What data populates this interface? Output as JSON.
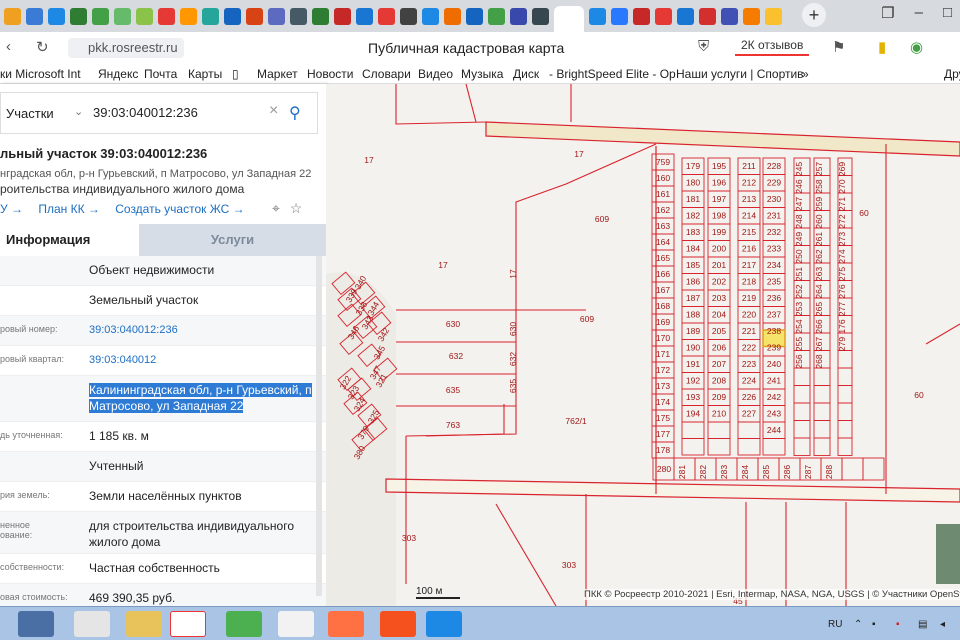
{
  "browser": {
    "url": "pkk.rosreestr.ru",
    "page_title": "Публичная кадастровая карта",
    "reviews_label": "2К отзывов",
    "bookmarks": [
      "ки Microsoft Int",
      "Яндекс",
      "Почта",
      "Карты",
      "Маркет",
      "Новости",
      "Словари",
      "Видео",
      "Музыка",
      "Диск",
      "- BrightSpeed Elite - Op",
      "Наши услуги | Спортив",
      "»",
      "Дру"
    ]
  },
  "panel": {
    "search_type": "Участки",
    "search_value": "39:03:040012:236",
    "object_title": "льный участок 39:03:040012:236",
    "object_address": "нградская обл, р-н Гурьевский, п Матросово, ул Западная 22",
    "object_purpose": "роительства индивидуального жилого дома",
    "links": [
      "У →",
      "План КК →",
      "Создать участок ЖС →"
    ],
    "tab_info": "Информация",
    "tab_services": "Услуги",
    "rows": [
      {
        "label": "",
        "value": "Объект недвижимости",
        "kind": "text"
      },
      {
        "label": "",
        "value": "Земельный участок",
        "kind": "text"
      },
      {
        "label": "ровый номер:",
        "value": "39:03:040012:236",
        "kind": "link"
      },
      {
        "label": "ровый квартал:",
        "value": "39:03:040012",
        "kind": "link"
      },
      {
        "label": "",
        "value": "Калининградская обл, р-н Гурьевский, п Матросово, ул Западная 22",
        "kind": "selected"
      },
      {
        "label": "дь уточненная:",
        "value": "1 185 кв. м",
        "kind": "text"
      },
      {
        "label": "",
        "value": "Учтенный",
        "kind": "text"
      },
      {
        "label": "рия земель:",
        "value": "Земли населённых пунктов",
        "kind": "text"
      },
      {
        "label": "ненное\nование:",
        "value": "для строительства индивидуального жилого дома",
        "kind": "text"
      },
      {
        "label": "собственности:",
        "value": "Частная собственность",
        "kind": "text"
      },
      {
        "label": "овая стоимость:",
        "value": "469 390,35 руб.",
        "kind": "text"
      }
    ]
  },
  "map": {
    "scale_label": "100 м",
    "attribution": "ПКК © Росреестр 2010-2021 | Esri, Intermap, NASA, NGA, USGS | © Участники OpenStreetMap",
    "highlight_color": "#f5e36a",
    "line_color": "#d9232d",
    "labels": [
      "17",
      "17",
      "609",
      "17",
      "17",
      "609",
      "630",
      "630",
      "632",
      "632",
      "635",
      "635",
      "763",
      "762/1",
      "303",
      "303",
      "60",
      "60",
      "45",
      "340",
      "339",
      "338",
      "344",
      "343",
      "342",
      "346",
      "345",
      "347",
      "321",
      "322",
      "323",
      "324",
      "325",
      "379",
      "380",
      "759",
      "160",
      "161",
      "162",
      "163",
      "164",
      "165",
      "166",
      "167",
      "168",
      "169",
      "170",
      "171",
      "172",
      "173",
      "174",
      "175",
      "177",
      "178",
      "179",
      "180",
      "181",
      "182",
      "183",
      "184",
      "185",
      "186",
      "187",
      "188",
      "189",
      "190",
      "191",
      "192",
      "193",
      "194",
      "195",
      "196",
      "197",
      "198",
      "199",
      "200",
      "201",
      "202",
      "203",
      "204",
      "205",
      "206",
      "207",
      "208",
      "209",
      "210",
      "211",
      "212",
      "213",
      "214",
      "215",
      "216",
      "217",
      "218",
      "219",
      "220",
      "221",
      "222",
      "223",
      "224",
      "226",
      "227",
      "228",
      "229",
      "230",
      "231",
      "232",
      "233",
      "234",
      "235",
      "236",
      "237",
      "238",
      "239",
      "240",
      "241",
      "242",
      "243",
      "244",
      "245",
      "246",
      "247",
      "248",
      "249",
      "250",
      "251",
      "252",
      "253",
      "254",
      "255",
      "256",
      "257",
      "258",
      "259",
      "260",
      "261",
      "262",
      "263",
      "264",
      "265",
      "266",
      "267",
      "268",
      "269",
      "270",
      "271",
      "272",
      "273",
      "274",
      "275",
      "276",
      "277",
      "176",
      "279",
      "280",
      "281",
      "282",
      "283",
      "284",
      "285",
      "286",
      "287",
      "288"
    ]
  },
  "taskbar": {
    "lang": "RU"
  }
}
